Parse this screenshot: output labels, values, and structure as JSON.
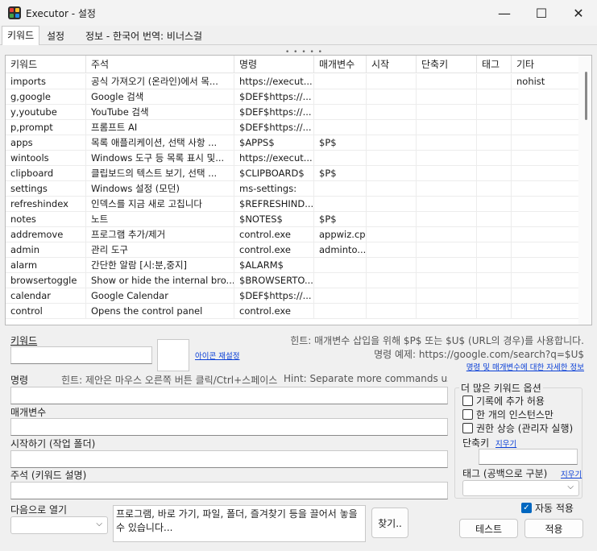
{
  "window": {
    "title": "Executor - 설정",
    "minimize_glyph": "—",
    "maximize_glyph": "☐",
    "close_glyph": "✕"
  },
  "tabs": [
    {
      "label": "키워드"
    },
    {
      "label": "설정"
    },
    {
      "label": "정보 - 한국어 번역: 비너스걸"
    }
  ],
  "splitter_grip": "• • • • •",
  "table": {
    "columns": [
      "키워드",
      "주석",
      "명령",
      "매개변수",
      "시작",
      "단축키",
      "태그",
      "기타"
    ],
    "rows": [
      [
        "imports",
        "공식 가져오기 (온라인)에서 목...",
        "https://execut...",
        "",
        "",
        "",
        "",
        "nohist"
      ],
      [
        "g,google",
        "Google 검색",
        "$DEF$https://...",
        "",
        "",
        "",
        "",
        ""
      ],
      [
        "y,youtube",
        "YouTube 검색",
        "$DEF$https://...",
        "",
        "",
        "",
        "",
        ""
      ],
      [
        "p,prompt",
        "프롬프트 AI",
        "$DEF$https://...",
        "",
        "",
        "",
        "",
        ""
      ],
      [
        "apps",
        "목록 애플리케이션, 선택 사항 ...",
        "$APPS$",
        "$P$",
        "",
        "",
        "",
        ""
      ],
      [
        "wintools",
        "Windows 도구 등 목록 표시 및...",
        "https://execut...",
        "",
        "",
        "",
        "",
        ""
      ],
      [
        "clipboard",
        "클립보드의 텍스트 보기, 선택 ...",
        "$CLIPBOARD$",
        "$P$",
        "",
        "",
        "",
        ""
      ],
      [
        "settings",
        "Windows 설정 (모던)",
        "ms-settings:",
        "",
        "",
        "",
        "",
        ""
      ],
      [
        "refreshindex",
        "인덱스를 지금 새로 고칩니다",
        "$REFRESHIND...",
        "",
        "",
        "",
        "",
        ""
      ],
      [
        "notes",
        "노트",
        "$NOTES$",
        "$P$",
        "",
        "",
        "",
        ""
      ],
      [
        "addremove",
        "프로그램 추가/제거",
        "control.exe",
        "appwiz.cpl",
        "",
        "",
        "",
        ""
      ],
      [
        "admin",
        "관리 도구",
        "control.exe",
        "adminto...",
        "",
        "",
        "",
        ""
      ],
      [
        "alarm",
        "간단한 알람 [시:분,중지]",
        "$ALARM$",
        "",
        "",
        "",
        "",
        ""
      ],
      [
        "browsertoggle",
        "Show or hide the internal bro...",
        "$BROWSERTO...",
        "",
        "",
        "",
        "",
        ""
      ],
      [
        "calendar",
        "Google Calendar",
        "$DEF$https://...",
        "",
        "",
        "",
        "",
        ""
      ],
      [
        "control",
        "Opens the control panel",
        "control.exe",
        "",
        "",
        "",
        "",
        ""
      ]
    ]
  },
  "form": {
    "keyword_label": "키워드",
    "keyword_value": "",
    "icon_reset_link": "아이콘 재설정",
    "hint_params": "힌트: 매개변수 삽입을 위해 $P$ 또는 $U$ (URL의 경우)를 사용합니다.",
    "hint_example": "명령 예제: https://google.com/search?q=$U$",
    "params_info_link": "명령 및 매개변수에 대한 자세한 정보",
    "command_label": "명령",
    "command_hint": "힌트: 제안은 마우스 오른쪽 버튼 클릭/Ctrl+스페이스",
    "command_hint2": "Hint: Separate more commands using ||",
    "command_value": "",
    "params_label": "매개변수",
    "params_value": "",
    "start_label": "시작하기 (작업 폴더)",
    "start_value": "",
    "comment_label": "주석 (키워드 설명)",
    "comment_value": "",
    "open_with_label": "다음으로 열기",
    "open_with_value": "",
    "drop_area_text": "프로그램, 바로 가기, 파일, 폴더, 즐겨찾기 등을 끌어서 놓을 수 있습니다...",
    "find_button": "찾기..",
    "more_options": {
      "title": "더 많은 키워드 옵션",
      "add_to_history": "기록에 추가 허용",
      "single_instance": "한 개의 인스턴스만",
      "elevated": "권한 상승 (관리자 실행)",
      "shortcut_label": "단축키",
      "shortcut_clear": "지우기",
      "shortcut_value": "",
      "tags_label": "태그 (공백으로 구분)",
      "tags_clear": "지우기",
      "tags_value": ""
    },
    "auto_apply_label": "자동 적용",
    "auto_apply_checked": true,
    "test_button": "테스트",
    "apply_button": "적용"
  },
  "colors": {
    "accent": "#0067c0",
    "link": "#0a3fd6"
  }
}
